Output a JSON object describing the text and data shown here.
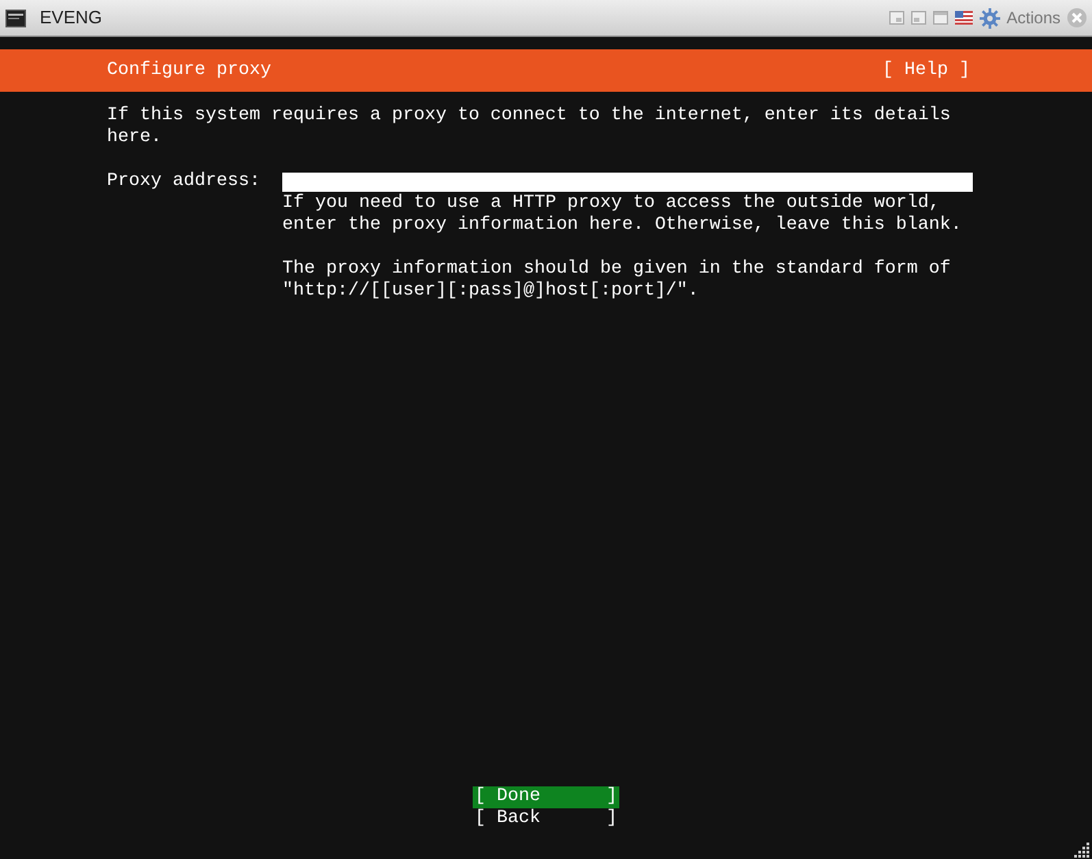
{
  "window": {
    "title": "EVENG",
    "actions_label": "Actions"
  },
  "header": {
    "title": "Configure proxy",
    "help": "[ Help ]"
  },
  "intro": "If this system requires a proxy to connect to the internet, enter its details here.",
  "proxy_field": {
    "label": "Proxy address:"
  },
  "help_paragraphs": [
    "If you need to use a HTTP proxy to access the outside world, enter the proxy information here. Otherwise, leave this blank.",
    "The proxy information should be given in the standard form of \"http://[[user][:pass]@]host[:port]/\"."
  ],
  "buttons": [
    {
      "label": "[ Done      ]",
      "selected": true
    },
    {
      "label": "[ Back      ]",
      "selected": false
    }
  ]
}
